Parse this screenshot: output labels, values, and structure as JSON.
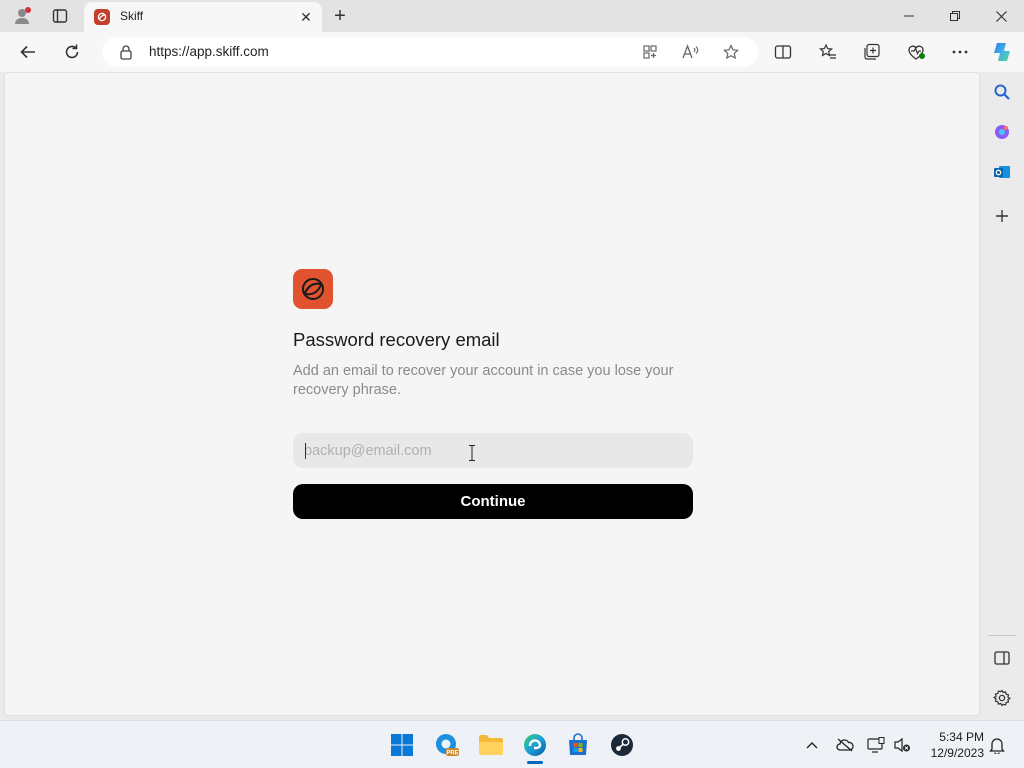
{
  "browser": {
    "tab_title": "Skiff",
    "url": "https://app.skiff.com",
    "new_tab_symbol": "+",
    "close_tab_symbol": "✕"
  },
  "page": {
    "heading": "Password recovery email",
    "description": "Add an email to recover your account in case you lose your recovery phrase.",
    "email_placeholder": "backup@email.com",
    "email_value": "",
    "continue_label": "Continue",
    "brand_color": "#e1532f"
  },
  "icons": {
    "titlebar": [
      "profile-icon",
      "tab-actions-icon"
    ],
    "toolbar": [
      "back-icon",
      "refresh-icon",
      "lock-icon",
      "app-available-icon",
      "read-aloud-icon",
      "favorite-star-icon",
      "split-screen-icon",
      "favorites-icon",
      "collections-icon",
      "browser-essentials-icon",
      "more-icon",
      "copilot-icon"
    ],
    "sidebar": [
      "search-icon",
      "copilot-apps-icon",
      "outlook-icon",
      "add-icon",
      "hide-sidebar-icon",
      "settings-icon"
    ],
    "taskbar": [
      "start-icon",
      "edge-beta-icon",
      "file-explorer-icon",
      "edge-icon",
      "store-icon",
      "steam-icon"
    ],
    "tray": [
      "chevron-up-icon",
      "onedrive-icon",
      "network-icon",
      "volume-muted-icon",
      "notification-icon"
    ]
  },
  "taskbar": {
    "time": "5:34 PM",
    "date": "12/9/2023",
    "pre_badge": "PRE"
  }
}
